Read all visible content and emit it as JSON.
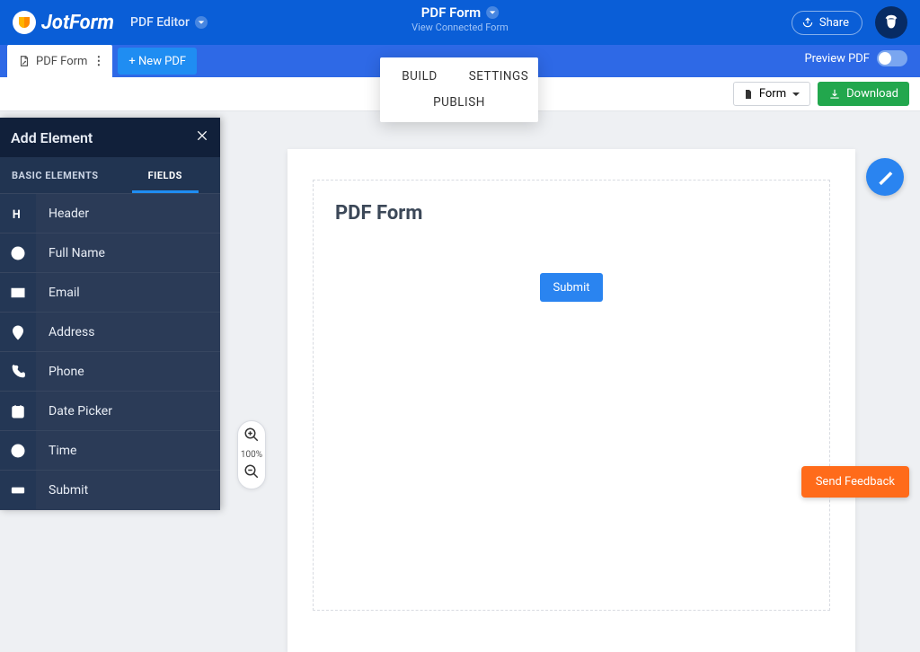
{
  "brand": {
    "name": "JotForm",
    "editor_label": "PDF Editor"
  },
  "header": {
    "title": "PDF Form",
    "subtitle": "View Connected Form",
    "share": "Share"
  },
  "tabs": {
    "active": "PDF Form",
    "new": "+ New PDF",
    "preview_label": "Preview PDF"
  },
  "modes": {
    "build": "BUILD",
    "settings": "SETTINGS",
    "publish": "PUBLISH"
  },
  "toolbar": {
    "form_dropdown": "Form",
    "download": "Download"
  },
  "sidebar": {
    "title": "Add Element",
    "tabs": {
      "basic": "BASIC ELEMENTS",
      "fields": "FIELDS"
    },
    "active_tab": "fields",
    "items": [
      {
        "icon": "header-icon",
        "label": "Header"
      },
      {
        "icon": "user-icon",
        "label": "Full Name"
      },
      {
        "icon": "mail-icon",
        "label": "Email"
      },
      {
        "icon": "pin-icon",
        "label": "Address"
      },
      {
        "icon": "phone-icon",
        "label": "Phone"
      },
      {
        "icon": "calendar-icon",
        "label": "Date Picker"
      },
      {
        "icon": "clock-icon",
        "label": "Time"
      },
      {
        "icon": "send-icon",
        "label": "Submit"
      }
    ]
  },
  "zoom": {
    "value": "100%"
  },
  "document": {
    "title": "PDF Form",
    "submit": "Submit"
  },
  "feedback": "Send Feedback",
  "colors": {
    "primary": "#0a5ed7",
    "accent": "#2a84f0",
    "green": "#22a74d",
    "orange": "#ff6b1a"
  }
}
